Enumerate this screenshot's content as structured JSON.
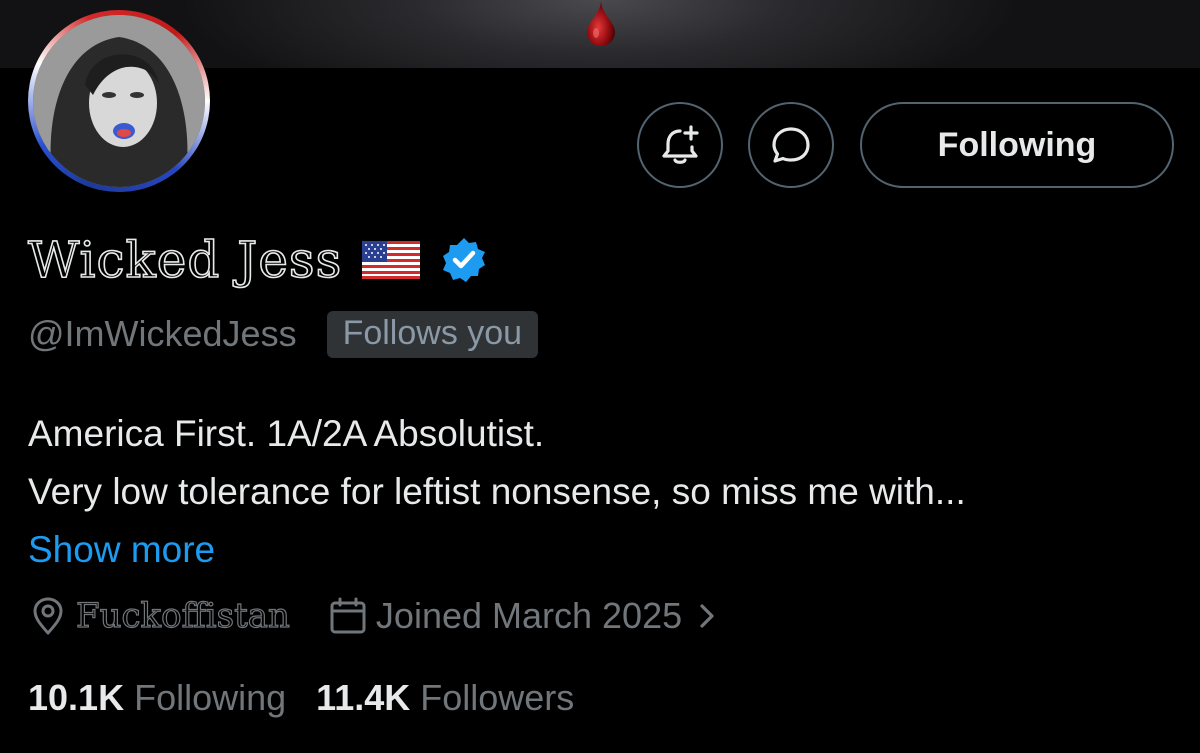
{
  "profile": {
    "display_name": "Wicked Jess",
    "flag_icon": "us-flag-icon",
    "verified_icon": "verified-badge-icon",
    "verified_color": "#1d9bf0",
    "handle": "@ImWickedJess",
    "follows_you": "Follows you",
    "bio_line_1": "America First. 1A/2A Absolutist.",
    "bio_line_2": "Very low tolerance for leftist nonsense, so miss me with...",
    "show_more": "Show more",
    "location": "Fuckoffistan",
    "joined": "Joined March 2025"
  },
  "actions": {
    "notify_icon": "bell-plus-icon",
    "message_icon": "message-bubble-icon",
    "follow_label": "Following"
  },
  "stats": {
    "following_count": "10.1K",
    "following_label": "Following",
    "followers_count": "11.4K",
    "followers_label": "Followers"
  },
  "colors": {
    "background": "#000000",
    "text_primary": "#e7e9ea",
    "text_secondary": "#71767b",
    "accent": "#1d9bf0",
    "border": "#536471"
  }
}
